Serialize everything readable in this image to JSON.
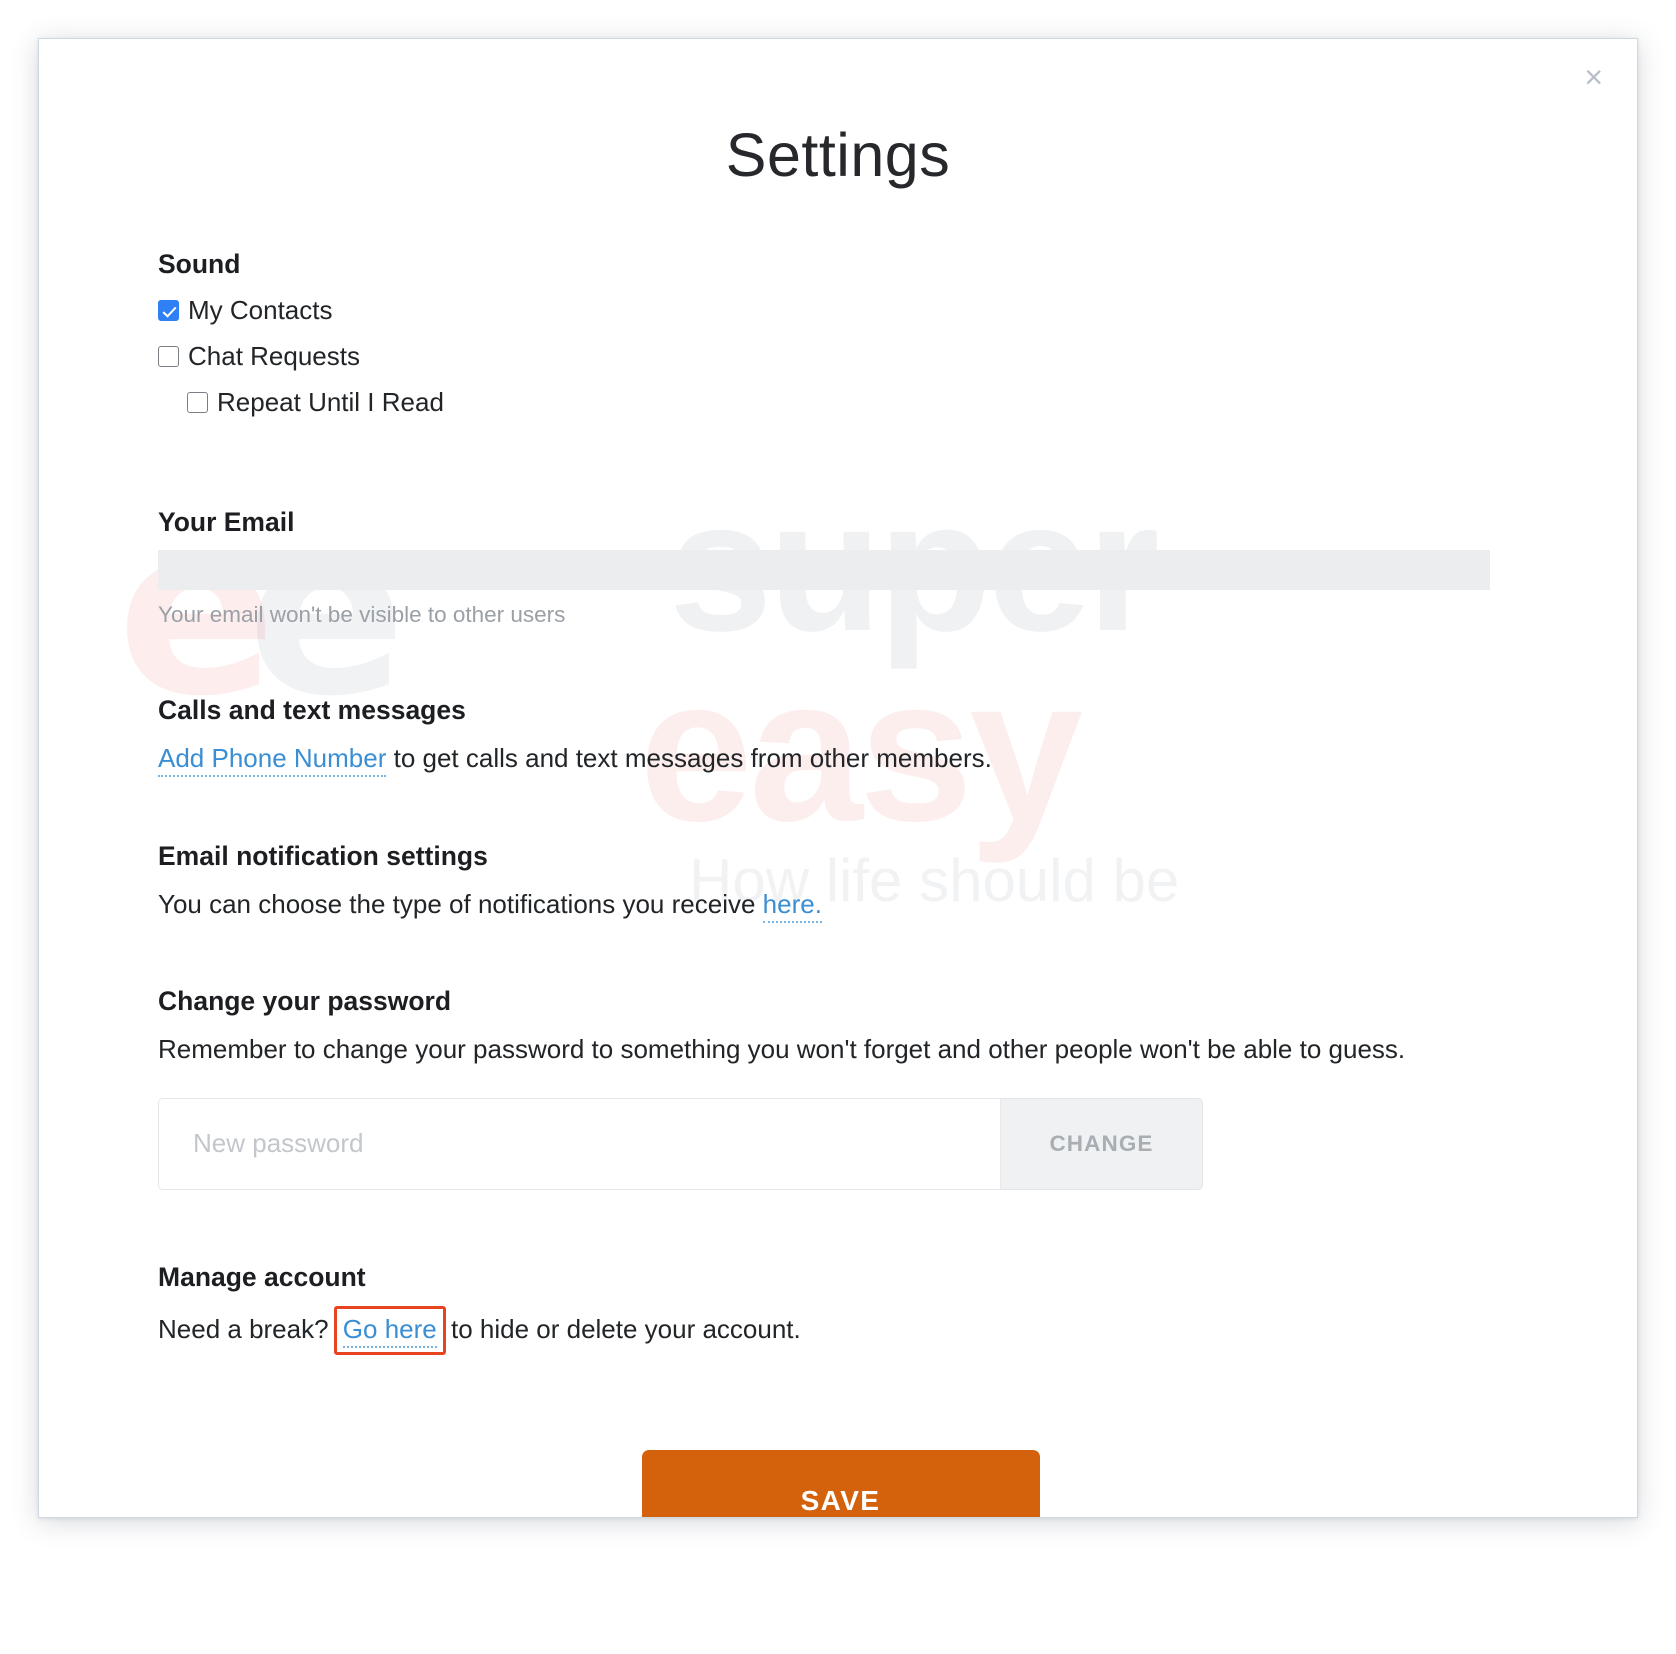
{
  "dialog": {
    "title": "Settings",
    "close_label": "×"
  },
  "watermark": {
    "mark_left": "e",
    "mark_right": "e",
    "word_top": "super",
    "word_bottom": "easy",
    "tagline": "How life should be"
  },
  "sound": {
    "heading": "Sound",
    "options": [
      {
        "label": "My Contacts",
        "checked": true,
        "indent": false
      },
      {
        "label": "Chat Requests",
        "checked": false,
        "indent": false
      },
      {
        "label": "Repeat Until I Read",
        "checked": false,
        "indent": true
      }
    ]
  },
  "email": {
    "heading": "Your Email",
    "value": "",
    "hint": "Your email won't be visible to other users"
  },
  "calls": {
    "heading": "Calls and text messages",
    "link_text": "Add Phone Number",
    "rest_text": " to get calls and text messages from other members."
  },
  "notifications": {
    "heading": "Email notification settings",
    "lead_text": "You can choose the type of notifications you receive ",
    "link_text": "here."
  },
  "password": {
    "heading": "Change your password",
    "description": "Remember to change your password to something you won't forget and other people won't be able to guess.",
    "input_value": "",
    "placeholder": "New password",
    "button_label": "CHANGE"
  },
  "manage": {
    "heading": "Manage account",
    "lead_text": "Need a break? ",
    "link_text": "Go here",
    "rest_text": " to hide or delete your account.",
    "highlight_color": "#e8441f"
  },
  "footer": {
    "save_label": "SAVE",
    "save_color": "#d4620d"
  }
}
